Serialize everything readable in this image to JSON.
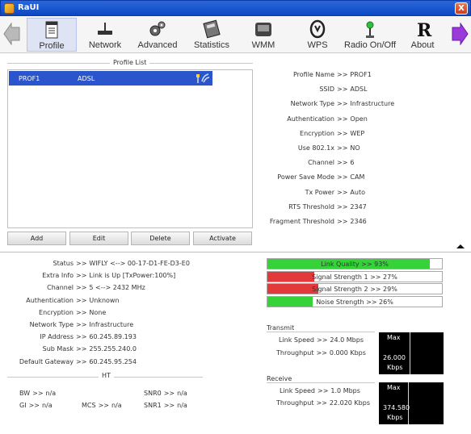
{
  "window": {
    "title": "RaUI",
    "close_label": "X"
  },
  "toolbar": {
    "items": [
      {
        "label": "Profile",
        "icon": "profile-icon"
      },
      {
        "label": "Network",
        "icon": "network-icon"
      },
      {
        "label": "Advanced",
        "icon": "advanced-icon"
      },
      {
        "label": "Statistics",
        "icon": "statistics-icon"
      },
      {
        "label": "WMM",
        "icon": "wmm-icon"
      },
      {
        "label": "WPS",
        "icon": "wps-icon"
      },
      {
        "label": "Radio On/Off",
        "icon": "radio-icon"
      },
      {
        "label": "About",
        "icon": "about-icon"
      }
    ]
  },
  "profile_list": {
    "title": "Profile List",
    "rows": [
      {
        "name": "PROF1",
        "ssid": "ADSL"
      }
    ],
    "buttons": {
      "add": "Add",
      "edit": "Edit",
      "delete": "Delete",
      "activate": "Activate"
    }
  },
  "profile_details": [
    {
      "key": "Profile Name",
      "value": "PROF1"
    },
    {
      "key": "SSID",
      "value": "ADSL"
    },
    {
      "key": "Network Type",
      "value": "Infrastructure"
    },
    {
      "key": "Authentication",
      "value": "Open"
    },
    {
      "key": "Encryption",
      "value": "WEP"
    },
    {
      "key": "Use 802.1x",
      "value": "NO"
    },
    {
      "key": "Channel",
      "value": "6"
    },
    {
      "key": "Power Save Mode",
      "value": "CAM"
    },
    {
      "key": "Tx Power",
      "value": "Auto"
    },
    {
      "key": "RTS Threshold",
      "value": "2347"
    },
    {
      "key": "Fragment Threshold",
      "value": "2346"
    }
  ],
  "sep": ">>",
  "status": [
    {
      "key": "Status",
      "value": "WIFLY <--> 00-17-D1-FE-D3-E0"
    },
    {
      "key": "Extra Info",
      "value": "Link is Up [TxPower:100%]"
    },
    {
      "key": "Channel",
      "value": "5 <--> 2432 MHz"
    },
    {
      "key": "Authentication",
      "value": "Unknown"
    },
    {
      "key": "Encryption",
      "value": "None"
    },
    {
      "key": "Network Type",
      "value": "Infrastructure"
    },
    {
      "key": "IP Address",
      "value": "60.245.89.193"
    },
    {
      "key": "Sub Mask",
      "value": "255.255.240.0"
    },
    {
      "key": "Default Gateway",
      "value": "60.245.95.254"
    }
  ],
  "ht": {
    "title": "HT",
    "bw": {
      "key": "BW",
      "value": "n/a"
    },
    "gi": {
      "key": "GI",
      "value": "n/a"
    },
    "mcs": {
      "key": "MCS",
      "value": "n/a"
    },
    "snr0": {
      "key": "SNR0",
      "value": "n/a"
    },
    "snr1": {
      "key": "SNR1",
      "value": "n/a"
    }
  },
  "quality": [
    {
      "label": "Link Quality >> 93%",
      "percent": 93,
      "color": "#35d23a"
    },
    {
      "label": "Signal Strength 1 >> 27%",
      "percent": 27,
      "color": "#e23a3a"
    },
    {
      "label": "Signal Strength 2 >> 29%",
      "percent": 29,
      "color": "#e23a3a"
    },
    {
      "label": "Noise Strength >> 26%",
      "percent": 26,
      "color": "#35d23a"
    }
  ],
  "transmit": {
    "title": "Transmit",
    "link_speed": {
      "key": "Link Speed",
      "value": "24.0 Mbps"
    },
    "throughput": {
      "key": "Throughput",
      "value": "0.000 Kbps"
    },
    "graph": {
      "max": "Max",
      "value": "26.000",
      "unit": "Kbps"
    }
  },
  "receive": {
    "title": "Receive",
    "link_speed": {
      "key": "Link Speed",
      "value": "1.0 Mbps"
    },
    "throughput": {
      "key": "Throughput",
      "value": "22.020 Kbps"
    },
    "graph": {
      "max": "Max",
      "value": "374.580",
      "unit": "Kbps"
    }
  }
}
